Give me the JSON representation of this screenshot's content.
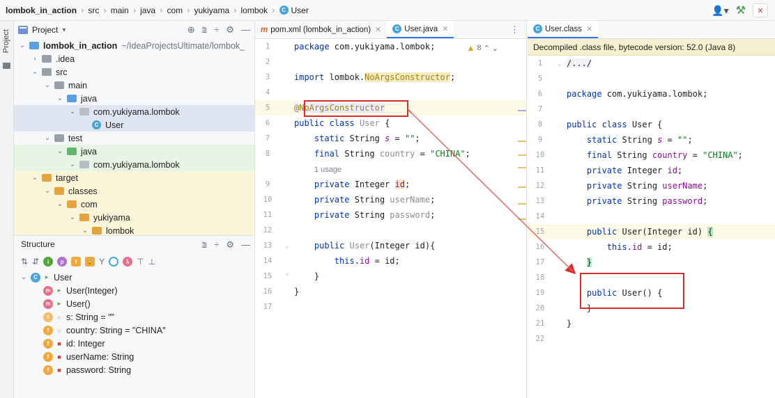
{
  "breadcrumb": [
    "lombok_in_action",
    "src",
    "main",
    "java",
    "com",
    "yukiyama",
    "lombok",
    "User"
  ],
  "project_pane": {
    "title": "Project",
    "side_label": "Project",
    "tree": [
      {
        "label": "lombok_in_action",
        "suffix": "~/IdeaProjectsUltimate/lombok_",
        "depth": 0,
        "chev": "v",
        "icon": "module",
        "bold": true
      },
      {
        "label": ".idea",
        "depth": 1,
        "chev": ">",
        "icon": "gray"
      },
      {
        "label": "src",
        "depth": 1,
        "chev": "v",
        "icon": "gray"
      },
      {
        "label": "main",
        "depth": 2,
        "chev": "v",
        "icon": "gray"
      },
      {
        "label": "java",
        "depth": 3,
        "chev": "v",
        "icon": "blue"
      },
      {
        "label": "com.yukiyama.lombok",
        "depth": 4,
        "chev": "v",
        "icon": "pkg",
        "selected": true
      },
      {
        "label": "User",
        "depth": 5,
        "chev": "",
        "icon": "class",
        "selected": true
      },
      {
        "label": "test",
        "depth": 2,
        "chev": "v",
        "icon": "gray"
      },
      {
        "label": "java",
        "depth": 3,
        "chev": "v",
        "icon": "green",
        "test": true
      },
      {
        "label": "com.yukiyama.lombok",
        "depth": 4,
        "chev": "v",
        "icon": "pkg",
        "test": true
      },
      {
        "label": "target",
        "depth": 1,
        "chev": "v",
        "icon": "orange",
        "target": true
      },
      {
        "label": "classes",
        "depth": 2,
        "chev": "v",
        "icon": "orange",
        "target": true
      },
      {
        "label": "com",
        "depth": 3,
        "chev": "v",
        "icon": "orange",
        "target": true
      },
      {
        "label": "yukiyama",
        "depth": 4,
        "chev": "v",
        "icon": "orange",
        "target": true
      },
      {
        "label": "lombok",
        "depth": 5,
        "chev": "v",
        "icon": "orange",
        "target": true
      }
    ]
  },
  "structure_pane": {
    "title": "Structure",
    "items": [
      {
        "label": "User",
        "badge": "c",
        "vis": "pub",
        "depth": 0,
        "chev": "v"
      },
      {
        "label": "User(Integer)",
        "badge": "m",
        "vis": "pub",
        "depth": 1
      },
      {
        "label": "User()",
        "badge": "m",
        "vis": "pub",
        "depth": 1
      },
      {
        "label": "s: String = \"\"",
        "badge": "fs",
        "vis": "pkg",
        "depth": 1
      },
      {
        "label": "country: String = \"CHINA\"",
        "badge": "f",
        "vis": "pkg",
        "depth": 1
      },
      {
        "label": "id: Integer",
        "badge": "f",
        "vis": "priv",
        "depth": 1
      },
      {
        "label": "userName: String",
        "badge": "f",
        "vis": "priv",
        "depth": 1
      },
      {
        "label": "password: String",
        "badge": "f",
        "vis": "priv",
        "depth": 1
      }
    ]
  },
  "left_editor": {
    "tabs": [
      {
        "label": "pom.xml (lombok_in_action)",
        "icon": "m",
        "active": false
      },
      {
        "label": "User.java",
        "icon": "c",
        "active": true
      }
    ],
    "warnings": "8"
  },
  "right_editor": {
    "tabs": [
      {
        "label": "User.class",
        "icon": "c",
        "active": true
      }
    ],
    "notice": "Decompiled .class file, bytecode version: 52.0 (Java 8)"
  },
  "colors": {
    "highlight_box": "#d92b2b",
    "arrow": "#d92b2b",
    "accent": "#3574f0"
  }
}
